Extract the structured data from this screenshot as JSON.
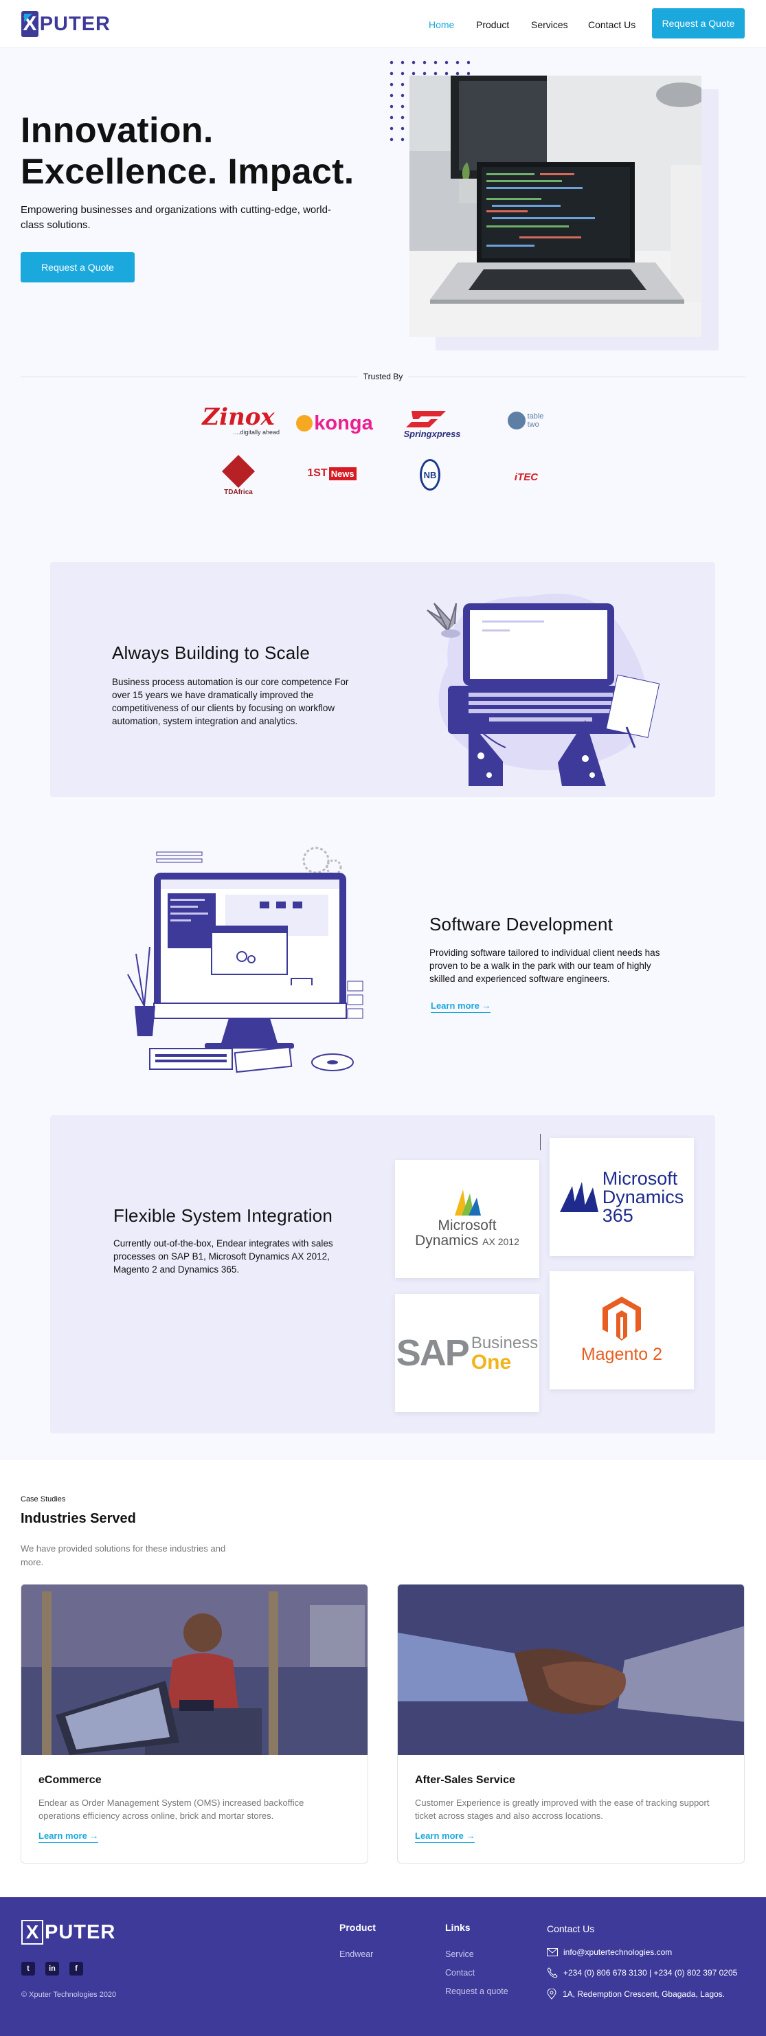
{
  "header": {
    "brand": "PUTER",
    "brand_x": "X",
    "nav": [
      {
        "label": "Home"
      },
      {
        "label": "Product"
      },
      {
        "label": "Services"
      },
      {
        "label": "Contact Us"
      }
    ],
    "cta": "Request a Quote"
  },
  "hero": {
    "title_line1": "Innovation.",
    "title_line2": "Excellence. Impact.",
    "subtitle": "Empowering businesses and organizations with cutting-edge, world-class solutions.",
    "cta": "Request a Quote"
  },
  "trusted": {
    "label": "Trusted By",
    "clients": [
      "Zinox",
      "....digitally ahead",
      "konga",
      "Springxpress",
      "table",
      "two",
      "TDAfrica",
      "1ST",
      "News",
      "NB",
      "iTEC"
    ]
  },
  "scale": {
    "title": "Always Building to Scale",
    "text": "Business process automation is our core competence For over 15 years we have dramatically improved the competitiveness of our clients by focusing on workflow automation, system integration and analytics."
  },
  "software": {
    "title": "Software Development",
    "text": "Providing software tailored to individual client needs has proven to be a walk in the park with our team of highly skilled and experienced software engineers.",
    "link": "Learn more"
  },
  "integration": {
    "title": "Flexible System Integration",
    "text": "Currently out-of-the-box, Endear integrates with sales processes on SAP B1, Microsoft Dynamics AX 2012, Magento 2 and Dynamics 365.",
    "logos": {
      "ms_ax_brand": "Microsoft",
      "ms_ax_product": "Dynamics",
      "ms_ax_version": "AX 2012",
      "ms365_brand": "Microsoft",
      "ms365_product": "Dynamics",
      "ms365_version": "365",
      "sap": "SAP",
      "sap_business": "Business",
      "sap_one": "One",
      "magento": "Magento",
      "magento_version": "2"
    }
  },
  "industries": {
    "eyebrow": "Case Studies",
    "title": "Industries Served",
    "subtitle": "We have provided solutions for these industries and more.",
    "cards": [
      {
        "title": "eCommerce",
        "text": "Endear as Order Management System (OMS) increased backoffice operations efficiency across online, brick and mortar stores.",
        "link": "Learn more"
      },
      {
        "title": "After-Sales Service",
        "text": "Customer Experience is greatly improved with the ease of tracking support ticket across stages and also accross locations.",
        "link": "Learn more"
      }
    ]
  },
  "footer": {
    "brand_x": "X",
    "brand": "PUTER",
    "copyright": "© Xputer Technologies 2020",
    "social": [
      "t",
      "in",
      "f"
    ],
    "product_head": "Product",
    "product_links": [
      "Endwear"
    ],
    "links_head": "Links",
    "links": [
      "Service",
      "Contact",
      "Request a quote"
    ],
    "contact_head": "Contact Us",
    "email": "info@xputertechnologies.com",
    "phone": "+234 (0) 806 678 3130 | +234 (0) 802 397 0205",
    "address": "1A, Redemption Crescent, Gbagada, Lagos."
  },
  "colors": {
    "brand": "#3e3a9a",
    "accent": "#1ba8dd",
    "section_bg": "#ececfb"
  }
}
